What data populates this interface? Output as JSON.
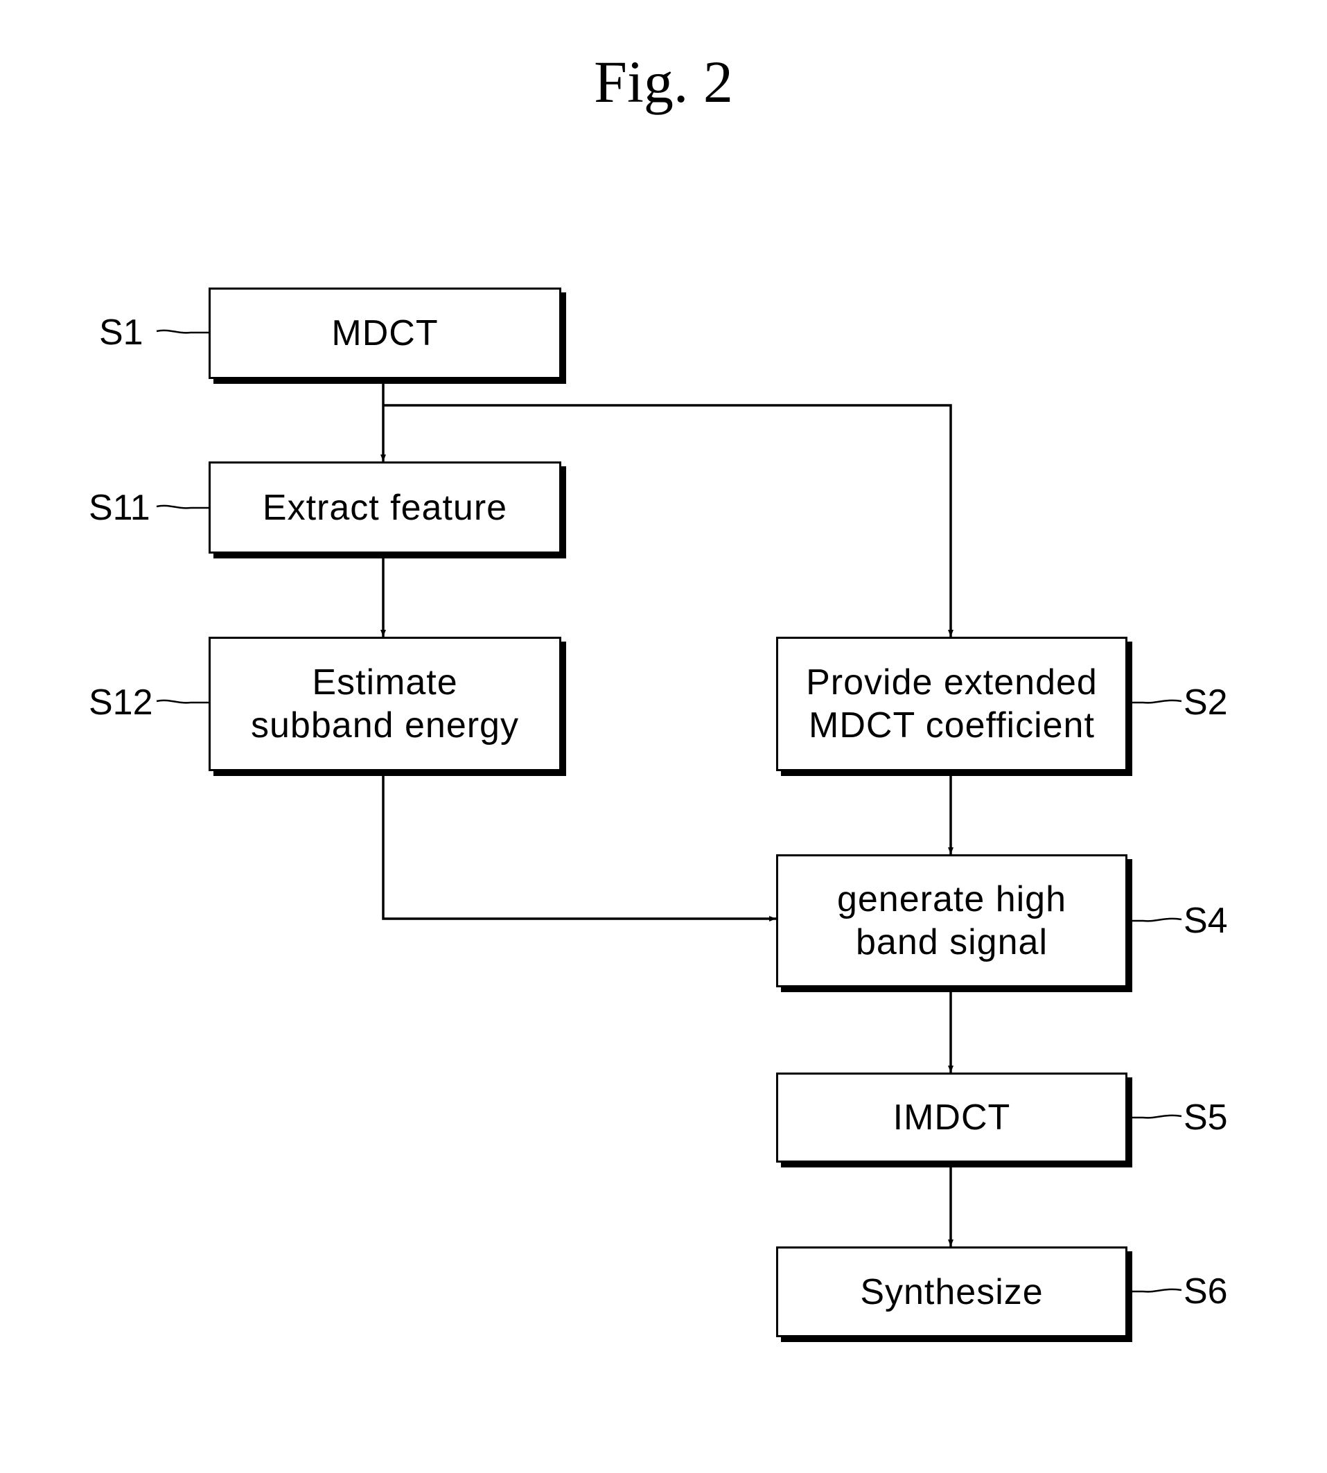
{
  "title": "Fig. 2",
  "steps": {
    "s1": {
      "id": "S1",
      "text": "MDCT"
    },
    "s11": {
      "id": "S11",
      "text": "Extract feature"
    },
    "s12": {
      "id": "S12",
      "line1": "Estimate",
      "line2": "subband energy"
    },
    "s2": {
      "id": "S2",
      "line1": "Provide extended",
      "line2": "MDCT coefficient"
    },
    "s4": {
      "id": "S4",
      "line1": "generate high",
      "line2": "band signal"
    },
    "s5": {
      "id": "S5",
      "text": "IMDCT"
    },
    "s6": {
      "id": "S6",
      "text": "Synthesize"
    }
  },
  "edges": [
    {
      "from": "S1",
      "to": "S11"
    },
    {
      "from": "S1",
      "to": "S2"
    },
    {
      "from": "S11",
      "to": "S12"
    },
    {
      "from": "S12",
      "to": "S4"
    },
    {
      "from": "S2",
      "to": "S4"
    },
    {
      "from": "S4",
      "to": "S5"
    },
    {
      "from": "S5",
      "to": "S6"
    }
  ]
}
